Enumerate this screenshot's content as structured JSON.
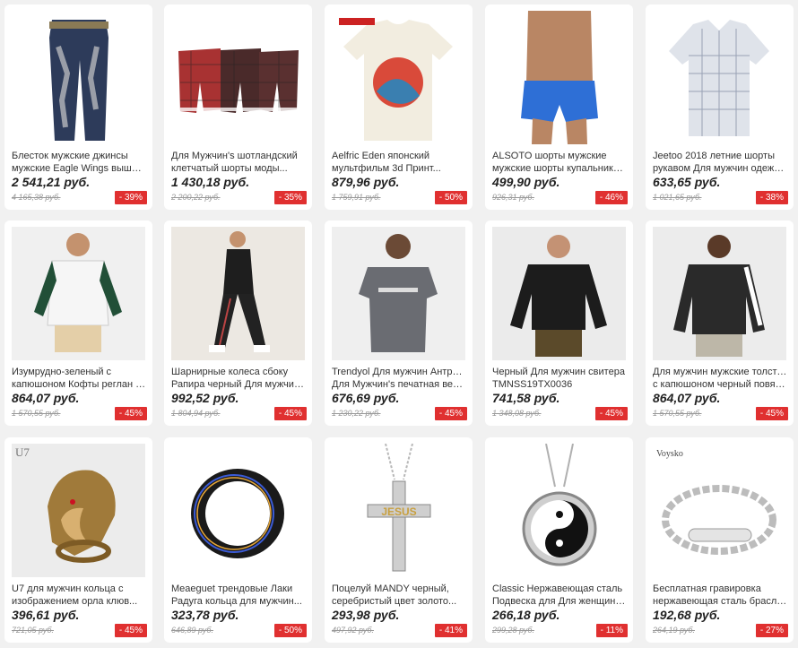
{
  "products": [
    {
      "line1": "Блесток мужские джинсы",
      "line2": "мужские Eagle Wings вышивка...",
      "price": "2 541,21 руб.",
      "old": "4 165,38 руб.",
      "discount": "- 39%",
      "icon": "jeans-icon"
    },
    {
      "line1": "Для Мужчин's шотландский",
      "line2": "клетчатый шорты моды...",
      "price": "1 430,18 руб.",
      "old": "2 200,22 руб.",
      "discount": "- 35%",
      "icon": "plaid-shorts-icon"
    },
    {
      "line1": "Aelfric Eden японский",
      "line2": "мультфильм 3d Принт...",
      "price": "879,96 руб.",
      "old": "1 759,91 руб.",
      "discount": "- 50%",
      "icon": "tshirt-icon"
    },
    {
      "line1": "ALSOTO шорты мужские",
      "line2": "мужские шорты купальники...",
      "price": "499,90 руб.",
      "old": "926,31 руб.",
      "discount": "- 46%",
      "icon": "swim-shorts-icon"
    },
    {
      "line1": "Jeetoo 2018 летние шорты",
      "line2": "рукавом Для мужчин одежда...",
      "price": "633,65 руб.",
      "old": "1 021,65 руб.",
      "discount": "- 38%",
      "icon": "shirt-icon"
    },
    {
      "line1": "Изумрудно-зеленый с",
      "line2": "капюшоном Кофты реглан ко...",
      "price": "864,07 руб.",
      "old": "1 570,55 руб.",
      "discount": "- 45%",
      "icon": "hoodie-icon"
    },
    {
      "line1": "Шарнирные колеса сбоку",
      "line2": "Рапира черный Для мужчин...",
      "price": "992,52 руб.",
      "old": "1 804,94 руб.",
      "discount": "- 45%",
      "icon": "tracksuit-icon"
    },
    {
      "line1": "Trendyol Для мужчин Антрацит",
      "line2": "Для Мужчин's печатная верси...",
      "price": "676,69 руб.",
      "old": "1 230,22 руб.",
      "discount": "- 45%",
      "icon": "tshirt-grey-icon"
    },
    {
      "line1": "Черный Для мужчин свитера",
      "line2": "TMNSS19TX0036",
      "price": "741,58 руб.",
      "old": "1 348,08 руб.",
      "discount": "- 45%",
      "icon": "sweater-icon"
    },
    {
      "line1": "Для мужчин мужские толстовки",
      "line2": "с капюшоном черный повязк...",
      "price": "864,07 руб.",
      "old": "1 570,55 руб.",
      "discount": "- 45%",
      "icon": "sweatshirt-icon"
    },
    {
      "line1": "U7 для мужчин кольца с",
      "line2": "изображением орла клюв...",
      "price": "396,61 руб.",
      "old": "721,05 руб.",
      "discount": "- 45%",
      "icon": "eagle-ring-icon",
      "brand": "U7"
    },
    {
      "line1": "Meaeguet трендовые Лаки",
      "line2": "Радуга кольца для мужчин...",
      "price": "323,78 руб.",
      "old": "646,89 руб.",
      "discount": "- 50%",
      "icon": "ring-icon"
    },
    {
      "line1": "Поцелуй MANDY черный,",
      "line2": "серебристый цвет золото...",
      "price": "293,98 руб.",
      "old": "497,92 руб.",
      "discount": "- 41%",
      "icon": "cross-pendant-icon",
      "badge": "JESUS"
    },
    {
      "line1": "Classic Нержавеющая сталь",
      "line2": "Подвеска для Для женщин Дл...",
      "price": "266,18 руб.",
      "old": "299,28 руб.",
      "discount": "- 11%",
      "icon": "yinyang-pendant-icon"
    },
    {
      "line1": "Бесплатная гравировка",
      "line2": "нержавеющая сталь браслет...",
      "price": "192,68 руб.",
      "old": "264,19 руб.",
      "discount": "- 27%",
      "icon": "bracelet-icon",
      "brand": "Voysko"
    }
  ],
  "colors": {
    "discount": "#e03030",
    "card": "#ffffff",
    "background": "#f1f1f1"
  }
}
